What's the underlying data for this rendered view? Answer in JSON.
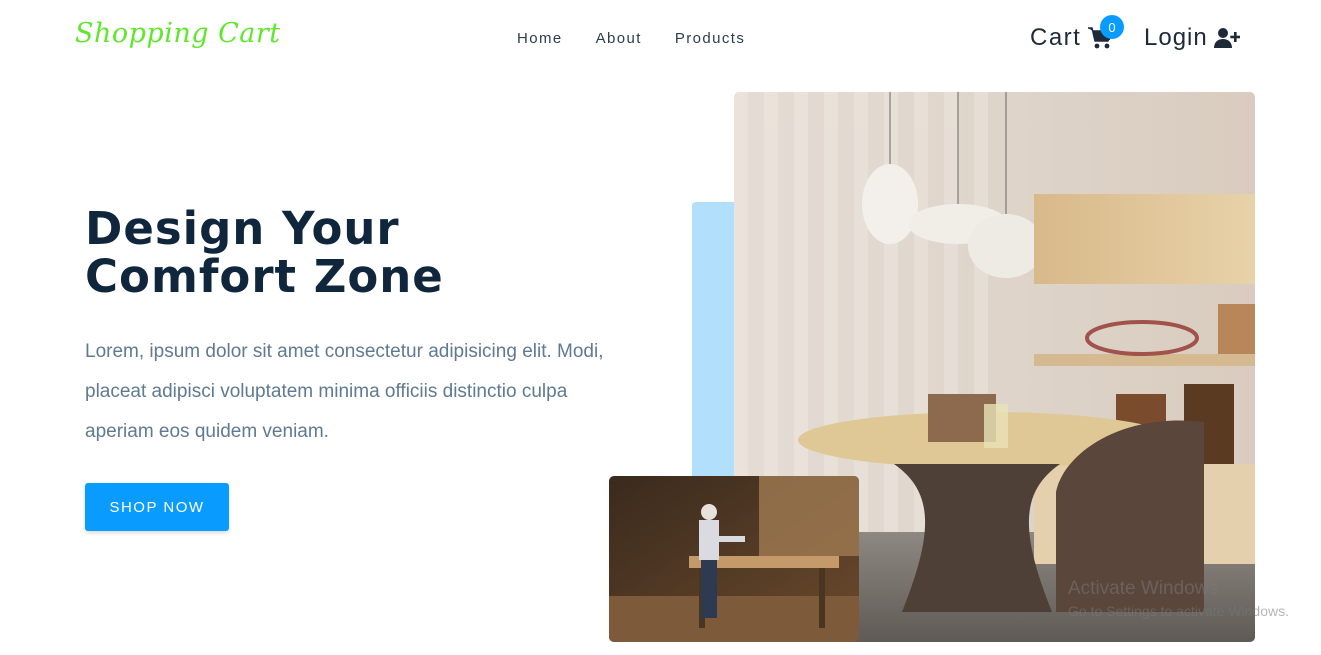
{
  "brand": {
    "logo_text": "Shopping Cart",
    "logo_color": "#5ee82c"
  },
  "nav": {
    "items": [
      {
        "label": "Home"
      },
      {
        "label": "About"
      },
      {
        "label": "Products"
      }
    ]
  },
  "header": {
    "cart_label": "Cart",
    "cart_count": "0",
    "login_label": "Login",
    "cart_icon": "shopping-cart-icon",
    "login_icon": "user-plus-icon"
  },
  "hero": {
    "title_line1": "Design Your",
    "title_line2": "Comfort Zone",
    "description": "Lorem, ipsum dolor sit amet consectetur adipisicing elit. Modi, placeat adipisci voluptatem minima officiis distinctio culpa aperiam eos quidem veniam.",
    "cta_label": "SHOP NOW"
  },
  "images": {
    "main": "interior-room-photo",
    "secondary": "carpenter-workshop-photo"
  },
  "watermark": {
    "title": "Activate Windows",
    "subtitle": "Go to Settings to activate Windows."
  },
  "colors": {
    "accent": "#0a9bff",
    "accent_light": "#b2dffc",
    "heading": "#10263d",
    "body_text": "#5f7a92"
  }
}
